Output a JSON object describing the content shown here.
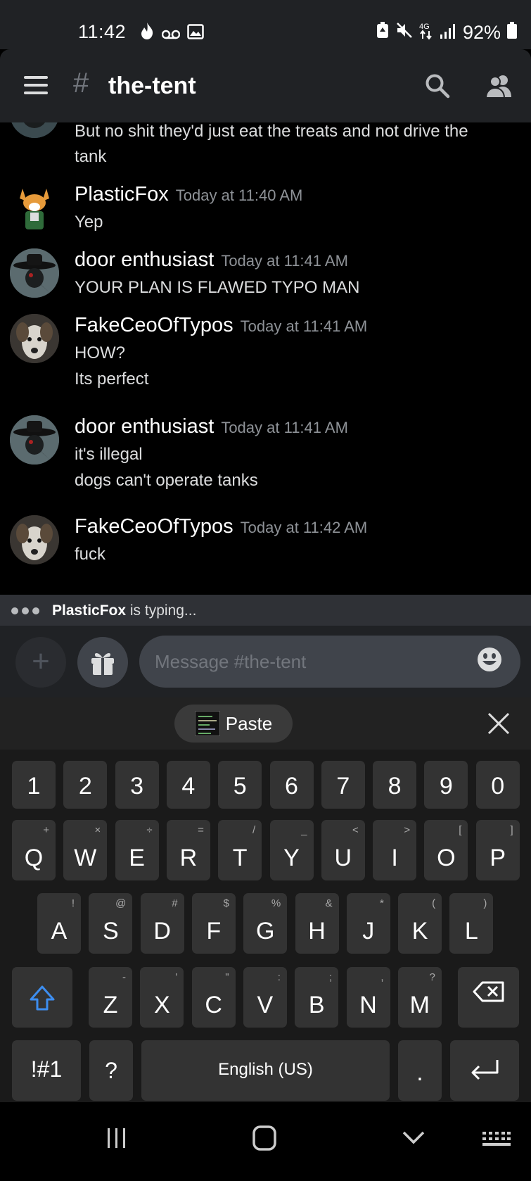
{
  "status_bar": {
    "time": "11:42",
    "battery": "92%"
  },
  "header": {
    "channel_name": "the-tent"
  },
  "messages": [
    {
      "author": "",
      "timestamp": "",
      "lines": [
        "But no shit they'd just eat the treats and not drive the",
        "tank"
      ]
    },
    {
      "author": "PlasticFox",
      "timestamp": "Today at 11:40 AM",
      "lines": [
        "Yep"
      ]
    },
    {
      "author": "door enthusiast",
      "timestamp": "Today at 11:41 AM",
      "lines": [
        "YOUR PLAN IS FLAWED TYPO MAN"
      ]
    },
    {
      "author": "FakeCeoOfTypos",
      "timestamp": "Today at 11:41 AM",
      "lines": [
        "HOW?",
        "Its perfect"
      ]
    },
    {
      "author": "door enthusiast",
      "timestamp": "Today at 11:41 AM",
      "lines": [
        "it's illegal",
        "dogs can't operate tanks"
      ]
    },
    {
      "author": "FakeCeoOfTypos",
      "timestamp": "Today at 11:42 AM",
      "lines": [
        "fuck"
      ]
    }
  ],
  "typing": {
    "user": "PlasticFox",
    "suffix": " is typing..."
  },
  "composer": {
    "placeholder": "Message #the-tent"
  },
  "keyboard": {
    "paste_label": "Paste",
    "number_row": [
      "1",
      "2",
      "3",
      "4",
      "5",
      "6",
      "7",
      "8",
      "9",
      "0"
    ],
    "row1": [
      {
        "k": "Q",
        "s": "+"
      },
      {
        "k": "W",
        "s": "×"
      },
      {
        "k": "E",
        "s": "÷"
      },
      {
        "k": "R",
        "s": "="
      },
      {
        "k": "T",
        "s": "/"
      },
      {
        "k": "Y",
        "s": "_"
      },
      {
        "k": "U",
        "s": "<"
      },
      {
        "k": "I",
        "s": ">"
      },
      {
        "k": "O",
        "s": "["
      },
      {
        "k": "P",
        "s": "]"
      }
    ],
    "row2": [
      {
        "k": "A",
        "s": "!"
      },
      {
        "k": "S",
        "s": "@"
      },
      {
        "k": "D",
        "s": "#"
      },
      {
        "k": "F",
        "s": "$"
      },
      {
        "k": "G",
        "s": "%"
      },
      {
        "k": "H",
        "s": "&"
      },
      {
        "k": "J",
        "s": "*"
      },
      {
        "k": "K",
        "s": "("
      },
      {
        "k": "L",
        "s": ")"
      }
    ],
    "row3": [
      {
        "k": "Z",
        "s": "-"
      },
      {
        "k": "X",
        "s": "'"
      },
      {
        "k": "C",
        "s": "\""
      },
      {
        "k": "V",
        "s": ":"
      },
      {
        "k": "B",
        "s": ";"
      },
      {
        "k": "N",
        "s": ","
      },
      {
        "k": "M",
        "s": "?"
      }
    ],
    "sym_label": "!#1",
    "question_label": "?",
    "space_label": "English (US)",
    "period_label": "."
  }
}
